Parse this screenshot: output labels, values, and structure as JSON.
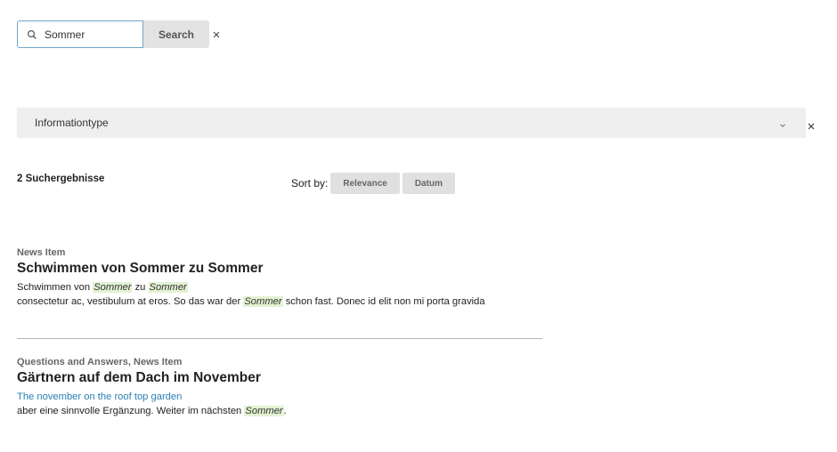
{
  "search": {
    "value": "Sommer",
    "button_label": "Search"
  },
  "filter": {
    "label": "Informationtype"
  },
  "results_summary": {
    "count_label": "2 Suchergebnisse",
    "sort_label": "Sort by:",
    "sort_options": [
      "Relevance",
      "Datum"
    ]
  },
  "results": [
    {
      "type": "News Item",
      "title": "Schwimmen von Sommer zu Sommer",
      "line1": [
        "Schwimmen von ",
        "Sommer",
        " zu ",
        "Sommer"
      ],
      "line2": [
        "consectetur ac, vestibulum at eros. So das war der ",
        "Sommer",
        " schon fast. Donec id elit non mi porta gravida"
      ]
    },
    {
      "type": "Questions and Answers, News Item",
      "title": "Gärtnern auf dem Dach im November",
      "link": "The november on the roof top garden",
      "line2": [
        "aber eine sinnvolle Ergänzung. Weiter im nächsten ",
        "Sommer",
        "."
      ]
    }
  ],
  "icons": {
    "search": "search-icon",
    "clear": "close-icon",
    "dropdown": "chevron-down-icon"
  },
  "colors": {
    "highlight": "#e2f2d2",
    "link": "#2a7fb5",
    "input_border": "#6fa6c9"
  }
}
